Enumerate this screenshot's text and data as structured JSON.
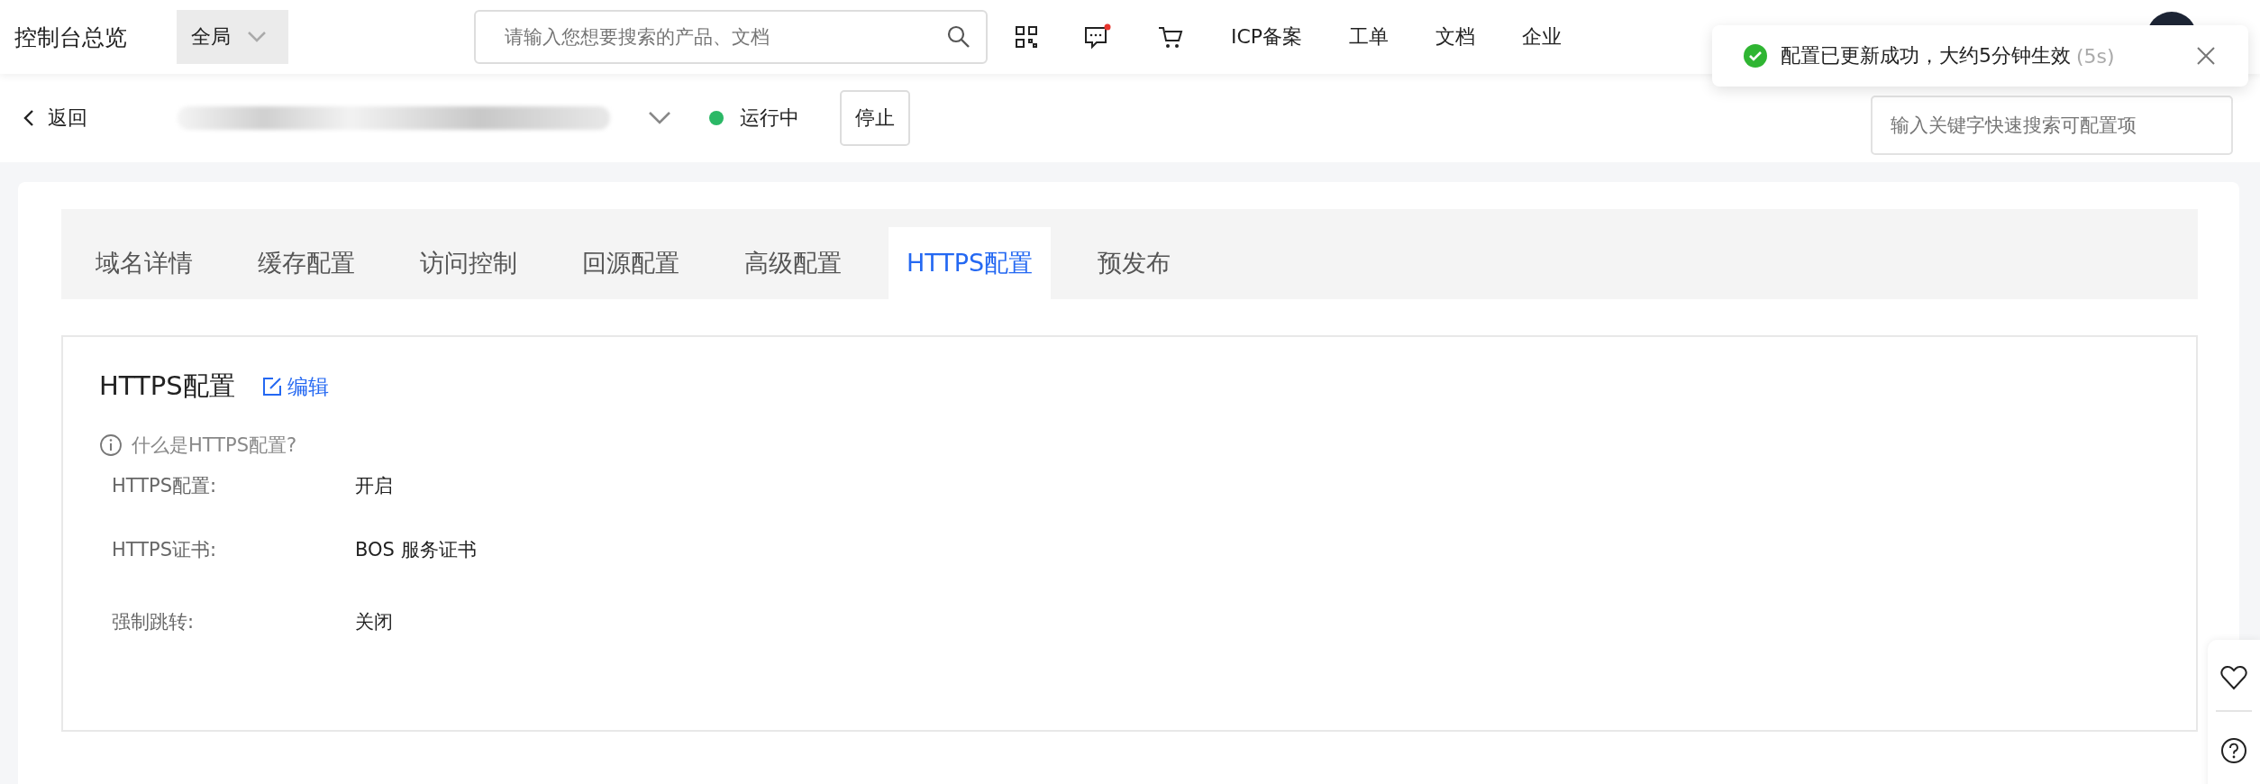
{
  "topbar": {
    "title": "控制台总览",
    "scope": "全局",
    "search": {
      "placeholder": "请输入您想要搜索的产品、文档"
    },
    "message_unread": true,
    "nav": [
      "ICP备案",
      "工单",
      "文档",
      "企业"
    ]
  },
  "toast": {
    "text": "配置已更新成功，大约5分钟生效",
    "countdown": "(5s)"
  },
  "header": {
    "back": "返回",
    "status": "运行中",
    "stop": "停止",
    "config_search": {
      "placeholder": "输入关键字快速搜索可配置项"
    }
  },
  "tabs": [
    {
      "label": "域名详情",
      "selected": false
    },
    {
      "label": "缓存配置",
      "selected": false
    },
    {
      "label": "访问控制",
      "selected": false
    },
    {
      "label": "回源配置",
      "selected": false
    },
    {
      "label": "高级配置",
      "selected": false
    },
    {
      "label": "HTTPS配置",
      "selected": true
    },
    {
      "label": "预发布",
      "selected": false
    }
  ],
  "section": {
    "title": "HTTPS配置",
    "edit": "编辑",
    "help": "什么是HTTPS配置?",
    "fields": [
      {
        "label": "HTTPS配置:",
        "value": "开启"
      },
      {
        "label": "HTTPS证书:",
        "value": "BOS 服务证书"
      },
      {
        "label": "强制跳转:",
        "value": "关闭"
      }
    ]
  }
}
